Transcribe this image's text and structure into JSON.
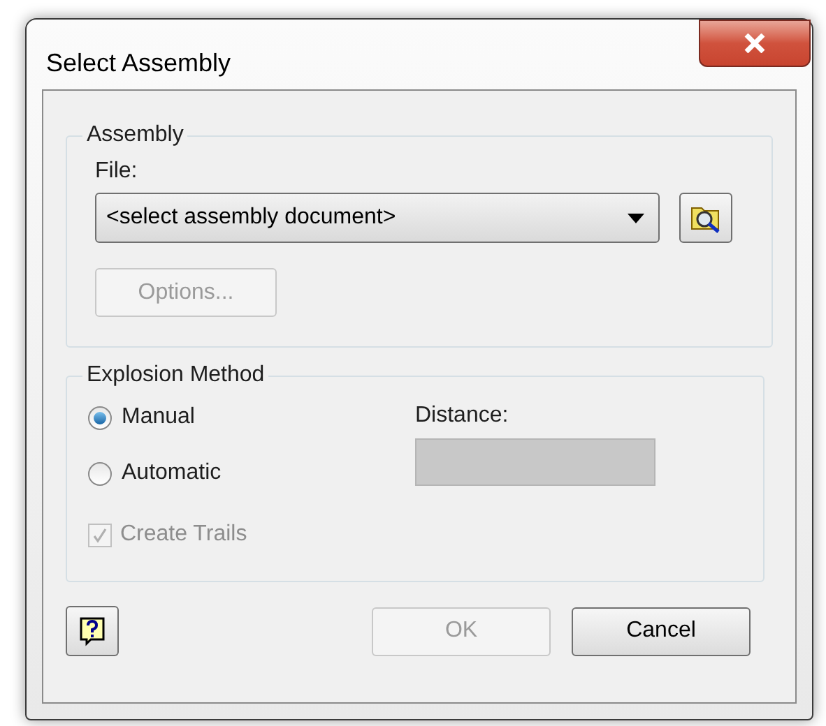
{
  "window": {
    "title": "Select Assembly"
  },
  "assembly": {
    "legend": "Assembly",
    "file_label": "File:",
    "file_value": "<select assembly document>",
    "options_button": {
      "label": "Options...",
      "disabled": true
    }
  },
  "explosion": {
    "legend": "Explosion Method",
    "methods": [
      {
        "label": "Manual",
        "selected": true
      },
      {
        "label": "Automatic",
        "selected": false
      }
    ],
    "create_trails": {
      "label": "Create Trails",
      "checked": true,
      "disabled": true
    },
    "distance_label": "Distance:",
    "distance_disabled": true
  },
  "buttons": [
    {
      "label": "OK",
      "disabled": true
    },
    {
      "label": "Cancel",
      "disabled": false
    }
  ]
}
